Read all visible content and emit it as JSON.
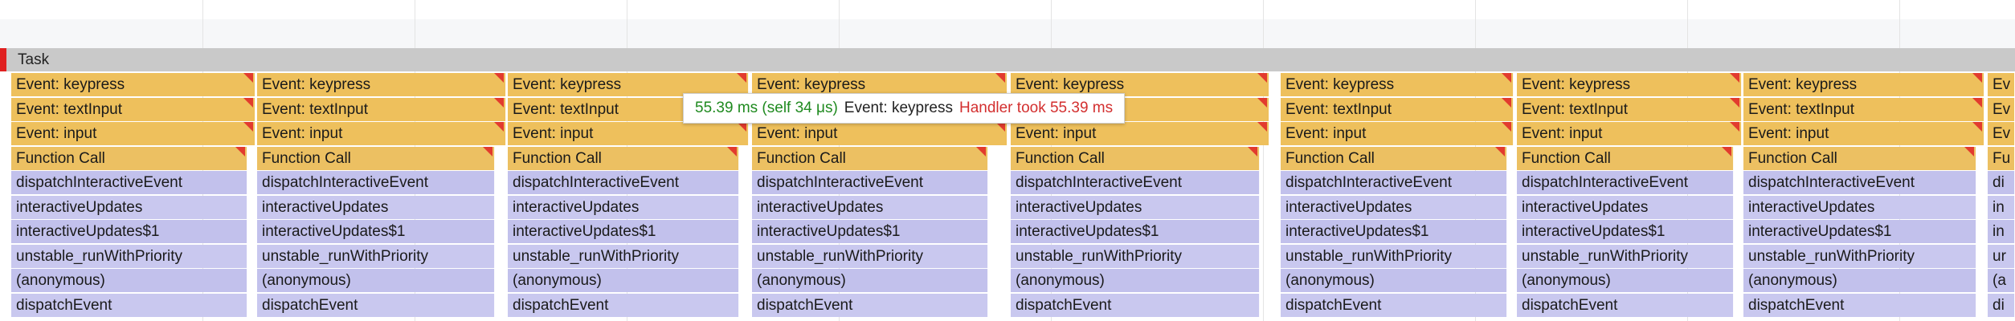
{
  "task_label": "Task",
  "frame_labels": [
    "Event: keypress",
    "Event: textInput",
    "Event: input",
    "Function Call",
    "dispatchInteractiveEvent",
    "interactiveUpdates",
    "interactiveUpdates$1",
    "unstable_runWithPriority",
    "(anonymous)",
    "dispatchEvent"
  ],
  "columns": [
    {
      "labels": [
        "Event: keypress",
        "Event: textInput",
        "Event: input",
        "Function Call",
        "dispatchInteractiveEvent",
        "interactiveUpdates",
        "interactiveUpdates$1",
        "unstable_runWithPriority",
        "(anonymous)",
        "dispatchEvent"
      ]
    },
    {
      "labels": [
        "Event: keypress",
        "Event: textInput",
        "Event: input",
        "Function Call",
        "dispatchInteractiveEvent",
        "interactiveUpdates",
        "interactiveUpdates$1",
        "unstable_runWithPriority",
        "(anonymous)",
        "dispatchEvent"
      ]
    },
    {
      "labels": [
        "Event: keypress",
        "Event: textInput",
        "Event: input",
        "Function Call",
        "dispatchInteractiveEvent",
        "interactiveUpdates",
        "interactiveUpdates$1",
        "unstable_runWithPriority",
        "(anonymous)",
        "dispatchEvent"
      ]
    },
    {
      "labels": [
        "Event: keypress",
        "",
        "Event: input",
        "Function Call",
        "dispatchInteractiveEvent",
        "interactiveUpdates",
        "interactiveUpdates$1",
        "unstable_runWithPriority",
        "(anonymous)",
        "dispatchEvent"
      ]
    },
    {
      "labels": [
        "Event: keypress",
        "",
        "Event: input",
        "Function Call",
        "dispatchInteractiveEvent",
        "interactiveUpdates",
        "interactiveUpdates$1",
        "unstable_runWithPriority",
        "(anonymous)",
        "dispatchEvent"
      ]
    },
    {
      "labels": [
        "Event: keypress",
        "Event: textInput",
        "Event: input",
        "Function Call",
        "dispatchInteractiveEvent",
        "interactiveUpdates",
        "interactiveUpdates$1",
        "unstable_runWithPriority",
        "(anonymous)",
        "dispatchEvent"
      ]
    },
    {
      "labels": [
        "Event: keypress",
        "Event: textInput",
        "Event: input",
        "Function Call",
        "dispatchInteractiveEvent",
        "interactiveUpdates",
        "interactiveUpdates$1",
        "unstable_runWithPriority",
        "(anonymous)",
        "dispatchEvent"
      ]
    },
    {
      "labels": [
        "Event: keypress",
        "Event: textInput",
        "Event: input",
        "Function Call",
        "dispatchInteractiveEvent",
        "interactiveUpdates",
        "interactiveUpdates$1",
        "unstable_runWithPriority",
        "(anonymous)",
        "dispatchEvent"
      ]
    },
    {
      "labels": [
        "Ev",
        "Ev",
        "Ev",
        "Fu",
        "di",
        "in",
        "in",
        "ur",
        "(a",
        "di"
      ]
    }
  ],
  "tooltip": {
    "duration": "55.39 ms (self 34 μs)",
    "name": "Event: keypress",
    "warning": "Handler took 55.39 ms"
  },
  "colors": {
    "event": "#eec05c",
    "function_call": "#ecc062",
    "js": "#c2c1ec",
    "task": "#c9c9c9",
    "warning_flag": "#e23b2e"
  }
}
